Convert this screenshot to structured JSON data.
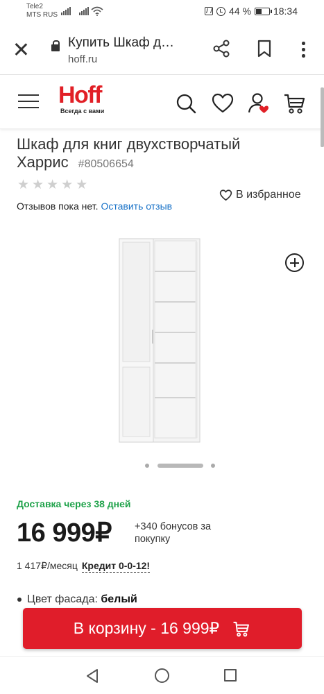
{
  "status_bar": {
    "carrier_1": "Tele2",
    "carrier_2": "MTS RUS",
    "battery": "44 %",
    "battery_level": 0.44,
    "time": "18:34"
  },
  "browser": {
    "title": "Купить Шкаф д…",
    "url": "hoff.ru",
    "icons": [
      "close-icon",
      "lock-icon",
      "share-icon",
      "bookmark-icon",
      "more-vert-icon"
    ]
  },
  "site_header": {
    "logo_text": "Hoff",
    "logo_tagline": "Всегда с вами",
    "brand_color": "#e11f26",
    "icons": [
      "menu-icon",
      "search-icon",
      "heart-icon",
      "account-icon",
      "cart-icon"
    ]
  },
  "product": {
    "title": "Шкаф для книг двухстворчатый Харрис",
    "sku": "#80506654",
    "rating": 0,
    "rating_max": 5,
    "favorite_label": "В избранное",
    "reviews_text": "Отзывов пока нет.",
    "review_link": "Оставить отзыв",
    "delivery": "Доставка через 38 дней",
    "delivery_color": "#1fa24a",
    "price": "16 999₽",
    "bonus": "+340 бонусов за покупку",
    "monthly": "1 417₽/месяц",
    "credit": "Кредит 0-0-12!",
    "specs": [
      {
        "label": "Цвет фасада:",
        "value": "белый"
      }
    ]
  },
  "gallery": {
    "slide_count": 3,
    "active_slide": 2
  },
  "cart_button": {
    "label": "В корзину - 16 999₽",
    "color": "#e01d2a"
  }
}
